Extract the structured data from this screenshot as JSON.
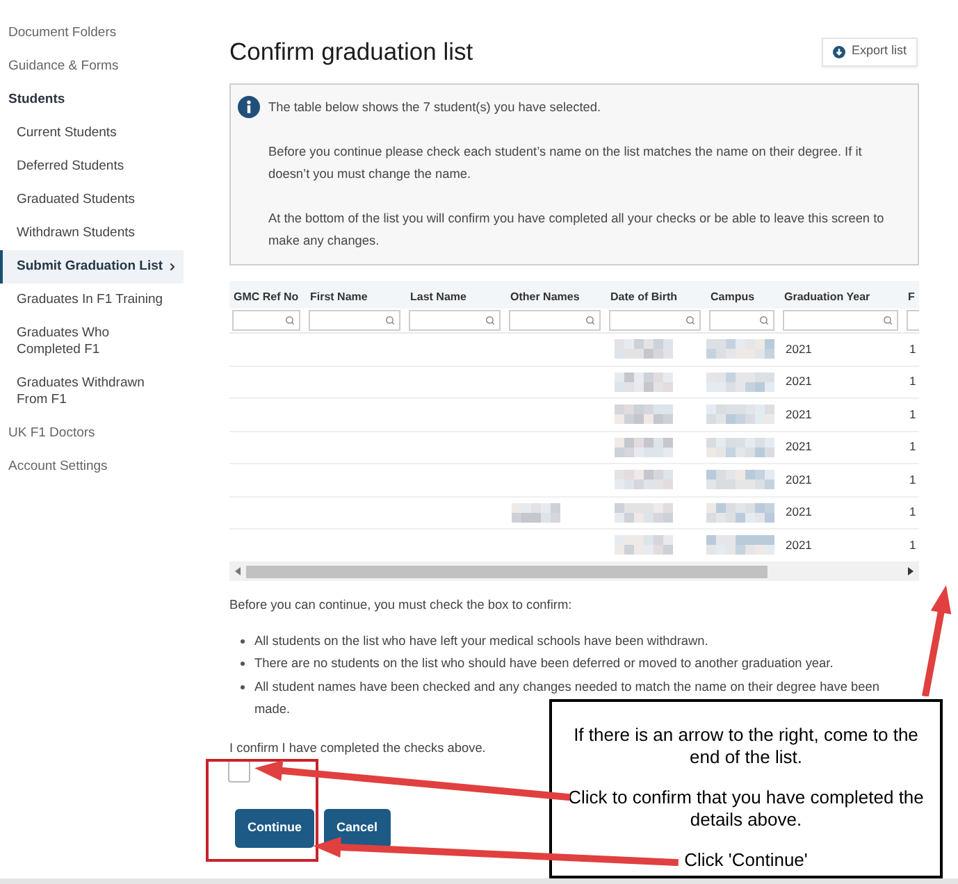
{
  "sidebar": {
    "items": [
      {
        "label": "Document Folders",
        "selected": false
      },
      {
        "label": "Guidance & Forms",
        "selected": false
      },
      {
        "label": "Students",
        "selected": false,
        "expanded": true,
        "children": [
          {
            "label": "Current Students",
            "selected": false
          },
          {
            "label": "Deferred Students",
            "selected": false
          },
          {
            "label": "Graduated Students",
            "selected": false
          },
          {
            "label": "Withdrawn Students",
            "selected": false
          },
          {
            "label": "Submit Graduation List",
            "selected": true
          },
          {
            "label": "Graduates In F1 Training",
            "selected": false
          },
          {
            "label": "Graduates Who Completed F1",
            "selected": false
          },
          {
            "label": "Graduates Withdrawn From F1",
            "selected": false
          }
        ]
      },
      {
        "label": "UK F1 Doctors",
        "selected": false
      },
      {
        "label": "Account Settings",
        "selected": false
      }
    ]
  },
  "page": {
    "title": "Confirm graduation list",
    "export_button": "Export list"
  },
  "info": {
    "paragraphs": [
      "The table below shows the 7 student(s) you have selected.",
      "Before you continue please check each student’s name on the list matches the name on their degree. If it doesn’t you must change the name.",
      "At the bottom of the list you will confirm you have completed all your checks or be able to leave this screen to make any changes."
    ]
  },
  "table": {
    "columns": [
      "GMC Ref No",
      "First Name",
      "Last Name",
      "Other Names",
      "Date of Birth",
      "Campus",
      "Graduation Year",
      "F"
    ],
    "rows": [
      {
        "cells": [
          {
            "kind": "blank"
          },
          {
            "kind": "blank"
          },
          {
            "kind": "blank"
          },
          {
            "kind": "blank"
          },
          {
            "kind": "pixelated"
          },
          {
            "kind": "pixelated"
          },
          {
            "kind": "text",
            "text": "2021"
          },
          {
            "kind": "text",
            "text": "1"
          }
        ]
      },
      {
        "cells": [
          {
            "kind": "blank"
          },
          {
            "kind": "blank"
          },
          {
            "kind": "blank"
          },
          {
            "kind": "blank"
          },
          {
            "kind": "pixelated"
          },
          {
            "kind": "pixelated"
          },
          {
            "kind": "text",
            "text": "2021"
          },
          {
            "kind": "text",
            "text": "1"
          }
        ]
      },
      {
        "cells": [
          {
            "kind": "blank"
          },
          {
            "kind": "blank"
          },
          {
            "kind": "blank"
          },
          {
            "kind": "blank"
          },
          {
            "kind": "pixelated"
          },
          {
            "kind": "pixelated"
          },
          {
            "kind": "text",
            "text": "2021"
          },
          {
            "kind": "text",
            "text": "1"
          }
        ]
      },
      {
        "cells": [
          {
            "kind": "blank"
          },
          {
            "kind": "blank"
          },
          {
            "kind": "blank"
          },
          {
            "kind": "blank"
          },
          {
            "kind": "pixelated"
          },
          {
            "kind": "pixelated"
          },
          {
            "kind": "text",
            "text": "2021"
          },
          {
            "kind": "text",
            "text": "1"
          }
        ]
      },
      {
        "cells": [
          {
            "kind": "blank"
          },
          {
            "kind": "blank"
          },
          {
            "kind": "blank"
          },
          {
            "kind": "blank"
          },
          {
            "kind": "pixelated"
          },
          {
            "kind": "pixelated"
          },
          {
            "kind": "text",
            "text": "2021"
          },
          {
            "kind": "text",
            "text": "1"
          }
        ]
      },
      {
        "cells": [
          {
            "kind": "blank"
          },
          {
            "kind": "blank"
          },
          {
            "kind": "blank"
          },
          {
            "kind": "pixelated"
          },
          {
            "kind": "pixelated"
          },
          {
            "kind": "pixelated"
          },
          {
            "kind": "text",
            "text": "2021"
          },
          {
            "kind": "text",
            "text": "1"
          }
        ]
      },
      {
        "cells": [
          {
            "kind": "blank"
          },
          {
            "kind": "blank"
          },
          {
            "kind": "blank"
          },
          {
            "kind": "blank"
          },
          {
            "kind": "pixelated"
          },
          {
            "kind": "pixelated"
          },
          {
            "kind": "text",
            "text": "2021"
          },
          {
            "kind": "text",
            "text": "1"
          }
        ]
      }
    ]
  },
  "confirm": {
    "intro": "Before you can continue, you must check the box to confirm:",
    "bullets": [
      "All students on the list who have left your medical schools have been withdrawn.",
      "There are no students on the list who should have been deferred or moved to another graduation year.",
      "All student names have been checked and any changes needed to match the name on their degree have been made."
    ],
    "label": "I confirm I have completed the checks above.",
    "checked": false
  },
  "buttons": [
    "Continue",
    "Cancel"
  ],
  "callout": {
    "paragraphs": [
      "If there is an arrow to the right, come to the end of the list.",
      "Click to confirm that you have completed the details above.",
      "Click 'Continue'"
    ]
  }
}
